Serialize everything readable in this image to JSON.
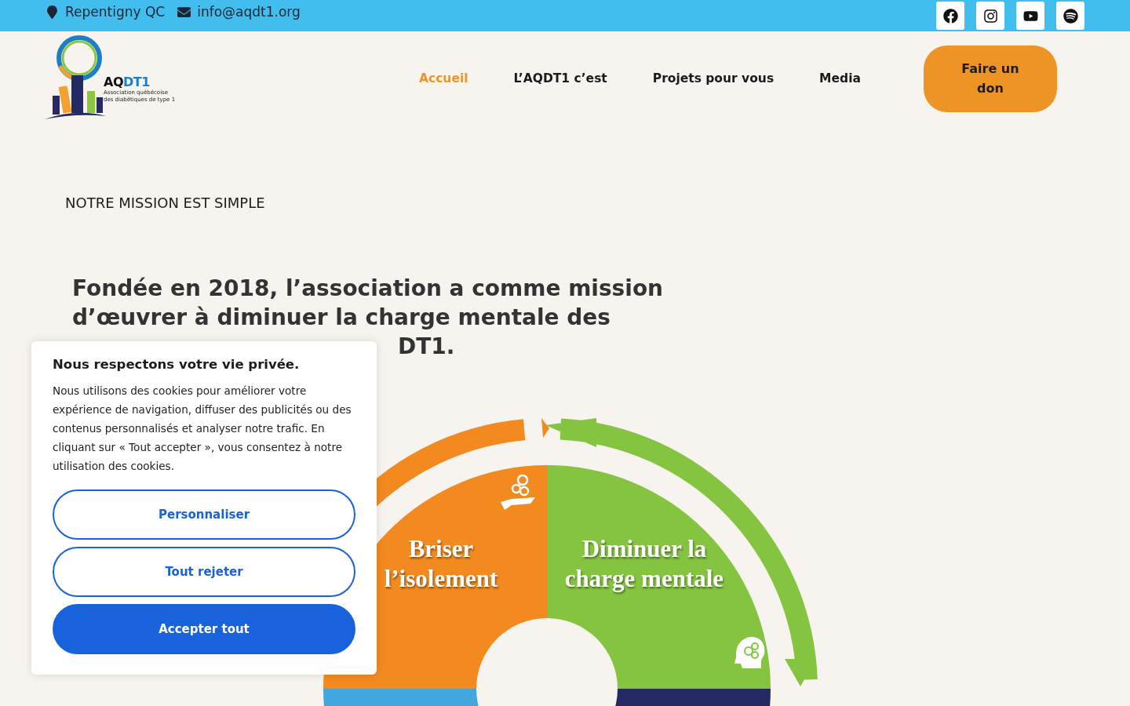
{
  "topbar": {
    "location": "Repentigny QC",
    "email": "info@aqdt1.org",
    "socials": [
      {
        "kind": "facebook"
      },
      {
        "kind": "instagram"
      },
      {
        "kind": "youtube"
      },
      {
        "kind": "spotify"
      }
    ]
  },
  "logo": {
    "wordmark_dark": "AQ",
    "wordmark_blue": "DT1",
    "tagline": [
      "Association québécoise",
      "des diabétiques de type 1"
    ]
  },
  "nav": {
    "items": [
      {
        "label": "Accueil",
        "selected": true
      },
      {
        "label": "L’AQDT1 c’est",
        "selected": false
      },
      {
        "label": "Projets pour vous",
        "selected": false
      },
      {
        "label": "Media",
        "selected": false
      }
    ],
    "donate": "Faire un don"
  },
  "mission": {
    "eyebrow": "NOTRE MISSION EST SIMPLE",
    "heading": "Fondée en 2018, l’association a comme mission d’œuvrer à diminuer la charge mentale des",
    "heading_tail": "DT1.",
    "diagram": [
      {
        "kind": "orange",
        "lines": [
          "Briser",
          "l’isolement"
        ]
      },
      {
        "kind": "green",
        "lines": [
          "Diminuer la",
          "charge mentale"
        ]
      }
    ]
  },
  "cookie_banner": {
    "title": "Nous respectons votre vie privée.",
    "text": "Nous utilisons des cookies pour améliorer votre expérience de navigation, diffuser des publicités ou des contenus personnalisés et analyser notre trafic. En cliquant sur « Tout accepter », vous consentez à notre utilisation des cookies.",
    "buttons": [
      {
        "label": "Personnaliser",
        "kind": "outline"
      },
      {
        "label": "Tout rejeter",
        "kind": "outline"
      },
      {
        "label": "Accepter tout",
        "kind": "primary"
      }
    ]
  }
}
